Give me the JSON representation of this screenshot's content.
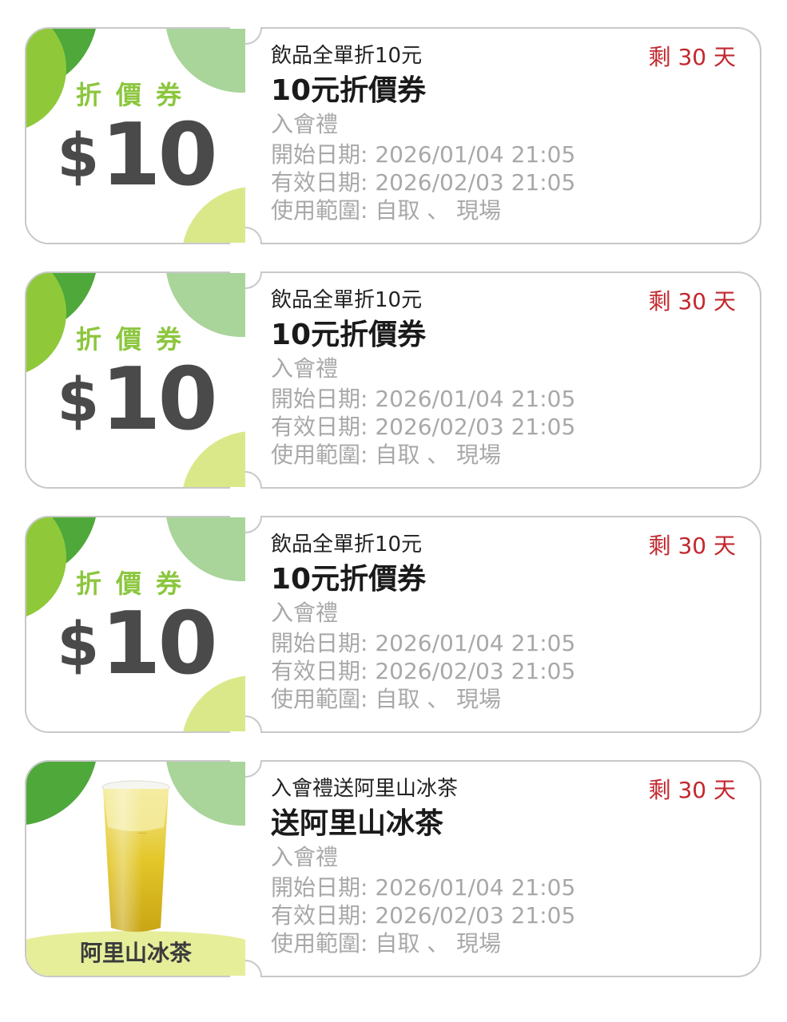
{
  "coupons": [
    {
      "tag": "折價券",
      "amount_symbol": "$",
      "amount": "10",
      "subtitle": "飲品全單折10元",
      "title": "10元折價券",
      "source": "入會禮",
      "start": "開始日期: 2026/01/04 21:05",
      "valid": "有效日期: 2026/02/03 21:05",
      "scope": "使用範圍: 自取 、 現場",
      "remaining": "剩 30 天"
    },
    {
      "tag": "折價券",
      "amount_symbol": "$",
      "amount": "10",
      "subtitle": "飲品全單折10元",
      "title": "10元折價券",
      "source": "入會禮",
      "start": "開始日期: 2026/01/04 21:05",
      "valid": "有效日期: 2026/02/03 21:05",
      "scope": "使用範圍: 自取 、 現場",
      "remaining": "剩 30 天"
    },
    {
      "tag": "折價券",
      "amount_symbol": "$",
      "amount": "10",
      "subtitle": "飲品全單折10元",
      "title": "10元折價券",
      "source": "入會禮",
      "start": "開始日期: 2026/01/04 21:05",
      "valid": "有效日期: 2026/02/03 21:05",
      "scope": "使用範圍: 自取 、 現場",
      "remaining": "剩 30 天"
    },
    {
      "drink_label": "阿里山冰茶",
      "subtitle": "入會禮送阿里山冰茶",
      "title": "送阿里山冰茶",
      "source": "入會禮",
      "start": "開始日期: 2026/01/04 21:05",
      "valid": "有效日期: 2026/02/03 21:05",
      "scope": "使用範圍: 自取 、 現場",
      "remaining": "剩 30 天"
    }
  ],
  "colors": {
    "accent_green": "#8cc63e",
    "remaining_red": "#c2282e",
    "meta_gray": "#a8a8a8",
    "outline_gray": "#c8c8c8"
  },
  "icons": {
    "drink": "iced-tea-cup-image"
  }
}
